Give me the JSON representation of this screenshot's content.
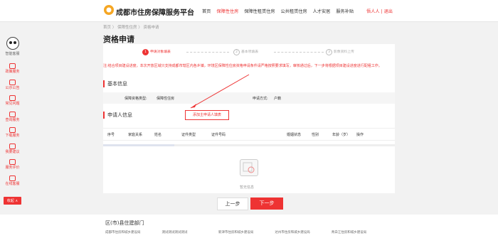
{
  "header": {
    "site_title": "成都市住房保障服务平台",
    "nav": [
      "首页",
      "保障性住房",
      "保障性租赁住房",
      "公共租赁住房",
      "人才安居",
      "服务补贴"
    ],
    "user": "悟人人 | 退出"
  },
  "sidebar": {
    "top_label": "智能客服",
    "items": [
      "政策服务",
      "公示公告",
      "常见问题",
      "查询服务",
      "下载服务",
      "我要建议",
      "服务评价",
      "在线客服"
    ],
    "collapse": "收起 ∧"
  },
  "breadcrumb": "首页 〉 保障性住房 〉 资格申请",
  "page_title": "资格申请",
  "steps": [
    "申请对象填表",
    "基本项填表",
    "影像资料上传"
  ],
  "notice": "注:结合项目建设进度，本次开放区域只支持成都市辖区内各乡镇，环境区保障性住房资格申请条件请严格按照要求填写，审核通过后，下一步将根据项目建设进度进行配租工作。",
  "basic_info": {
    "section": "基本信息",
    "type_label": "保障资格类型:",
    "type_value": "保障性住房",
    "method_label": "申请方式:",
    "method_value": "户籍"
  },
  "applicant": {
    "section": "申请人信息",
    "add_button": "添加主申请人填表",
    "columns": [
      "序号",
      "家庭关系",
      "姓名",
      "证件类型",
      "证件号码",
      "婚姻状态",
      "性别",
      "年龄（岁）",
      "操作"
    ],
    "empty": "暂无信息"
  },
  "buttons": {
    "prev": "上一步",
    "next": "下一步"
  },
  "footer": {
    "title": "区(市)县住建部门",
    "links": [
      "成都市住房和城乡建设局",
      "测试测试测试测试",
      "新津市住房和城乡建设局",
      "达州市住房和城乡建设局",
      "青白江住房和城乡建设局"
    ]
  }
}
